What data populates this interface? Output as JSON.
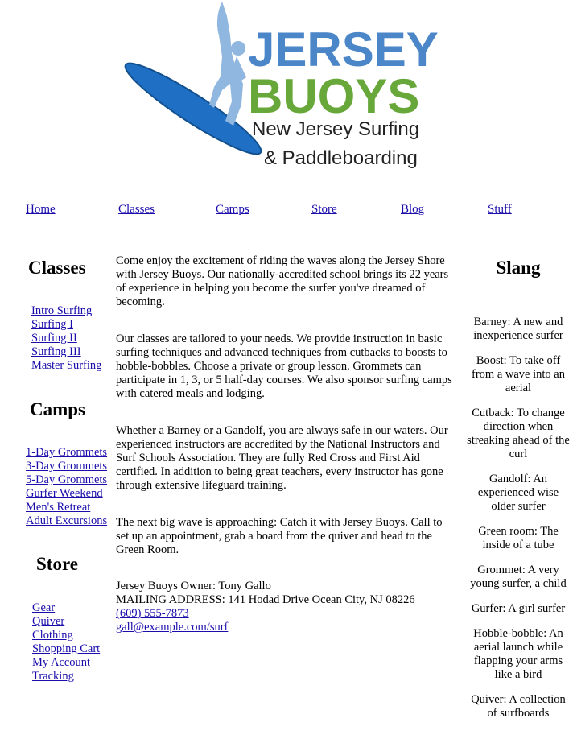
{
  "logo": {
    "line1": "JERSEY",
    "line2": "BUOYS",
    "tagline1": "New Jersey Surfing",
    "tagline2": "& Paddleboarding",
    "colors": {
      "blue": "#4a86c8",
      "green": "#68a83a",
      "board": "#1f6fc4",
      "surfer": "#8fb7df"
    }
  },
  "nav": [
    {
      "label": "Home"
    },
    {
      "label": "Classes"
    },
    {
      "label": "Camps"
    },
    {
      "label": "Store"
    },
    {
      "label": "Blog"
    },
    {
      "label": "Stuff"
    }
  ],
  "sidebar": {
    "classes": {
      "title": "Classes",
      "items": [
        "Intro Surfing",
        "Surfing I",
        "Surfing II",
        "Surfing III",
        "Master Surfing"
      ]
    },
    "camps": {
      "title": "Camps",
      "items": [
        "1-Day Grommets",
        "3-Day Grommets",
        "5-Day Grommets",
        "Gurfer Weekend",
        "Men's Retreat",
        "Adult Excursions"
      ]
    },
    "store": {
      "title": "Store",
      "items": [
        "Gear",
        "Quiver",
        "Clothing",
        "Shopping Cart",
        "My Account",
        "Tracking"
      ]
    }
  },
  "main": {
    "paragraphs": [
      "Come enjoy the excitement of riding the waves along the Jersey Shore with Jersey Buoys. Our nationally-accredited school brings its 22 years of experience in helping you become the surfer you've dreamed of becoming.",
      "Our classes are tailored to your needs. We provide instruction in basic surfing techniques and advanced techniques from cutbacks to boosts to hobble-bobbles. Choose a private or group lesson. Grommets can participate in 1, 3, or 5 half-day courses. We also sponsor surfing camps with catered meals and lodging.",
      "Whether a Barney or a Gandolf, you are always safe in our waters. Our experienced instructors are accredited by the National Instructors and Surf Schools Association. They are fully Red Cross and First Aid certified. In addition to being great teachers, every instructor has gone through extensive lifeguard training.",
      "The next big wave is approaching: Catch it with Jersey Buoys. Call to set up an appointment, grab a board from the quiver and head to the Green Room."
    ],
    "contact": {
      "owner": "Jersey Buoys Owner: Tony Gallo",
      "address": "MAILING ADDRESS: 141 Hodad Drive Ocean City, NJ 08226",
      "phone": "(609) 555-7873",
      "email": "gall@example.com/surf"
    }
  },
  "slang": {
    "title": "Slang",
    "items": [
      "Barney: A new and inexperience surfer",
      "Boost: To take off from a wave into an aerial",
      "Cutback: To change direction when streaking ahead of the curl",
      "Gandolf: An experienced wise older surfer",
      "Green room: The inside of a tube",
      "Grommet: A very young surfer, a child",
      "Gurfer: A girl surfer",
      "Hobble-bobble: An aerial launch while flapping your arms like a bird",
      "Quiver: A collection of surfboards"
    ]
  }
}
